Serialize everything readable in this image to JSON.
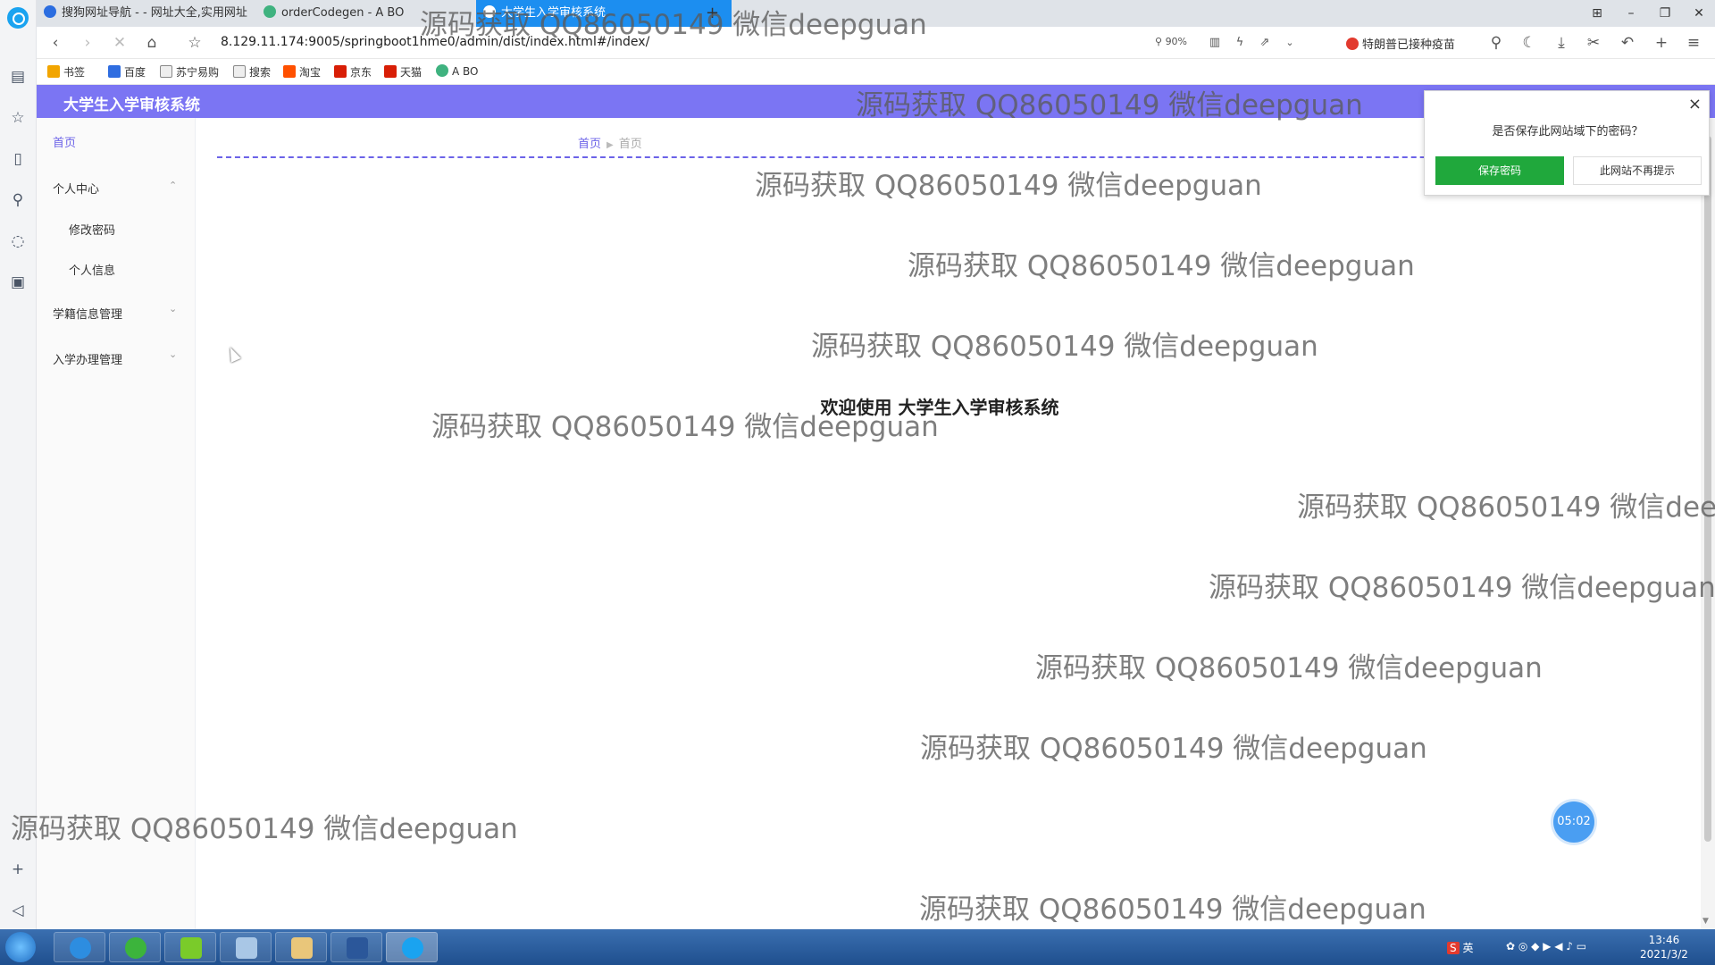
{
  "browser": {
    "tabs": [
      {
        "label": "搜狗网址导航 - - 网址大全,实用网址",
        "icon": "sogou-icon"
      },
      {
        "label": "orderCodegen - A BO",
        "icon": "vue-icon"
      },
      {
        "label": "大学生入学审核系统",
        "icon": "page-icon",
        "active": true
      }
    ],
    "new_tab_label": "+",
    "url": "8.129.11.174:9005/springboot1hme0/admin/dist/index.html#/index/",
    "zoom": "90%",
    "news": "特朗普已接种疫苗",
    "bookmarks": [
      "书签",
      "百度",
      "苏宁易购",
      "搜索",
      "淘宝",
      "京东",
      "天猫",
      "A BO"
    ]
  },
  "app": {
    "title": "大学生入学审核系统",
    "sidebar": {
      "home": "首页",
      "groups": [
        {
          "label": "个人中心",
          "expanded": true,
          "children": [
            "修改密码",
            "个人信息"
          ]
        },
        {
          "label": "学籍信息管理",
          "expanded": false,
          "children": []
        },
        {
          "label": "入学办理管理",
          "expanded": false,
          "children": []
        }
      ]
    },
    "breadcrumb": [
      "首页",
      "首页"
    ],
    "welcome": "欢迎使用 大学生入学审核系统",
    "timer": "05:02"
  },
  "password_prompt": {
    "question": "是否保存此网站域下的密码？",
    "save": "保存密码",
    "never": "此网站不再提示",
    "close": "×"
  },
  "watermark": "源码获取 QQ86050149 微信deepguan",
  "taskbar": {
    "ime": "英",
    "time": "13:46",
    "date": "2021/3/2"
  },
  "colors": {
    "header": "#7b75f3",
    "accent": "#6c63e8",
    "save_button": "#20a83c",
    "active_tab": "#1c8ef0"
  }
}
